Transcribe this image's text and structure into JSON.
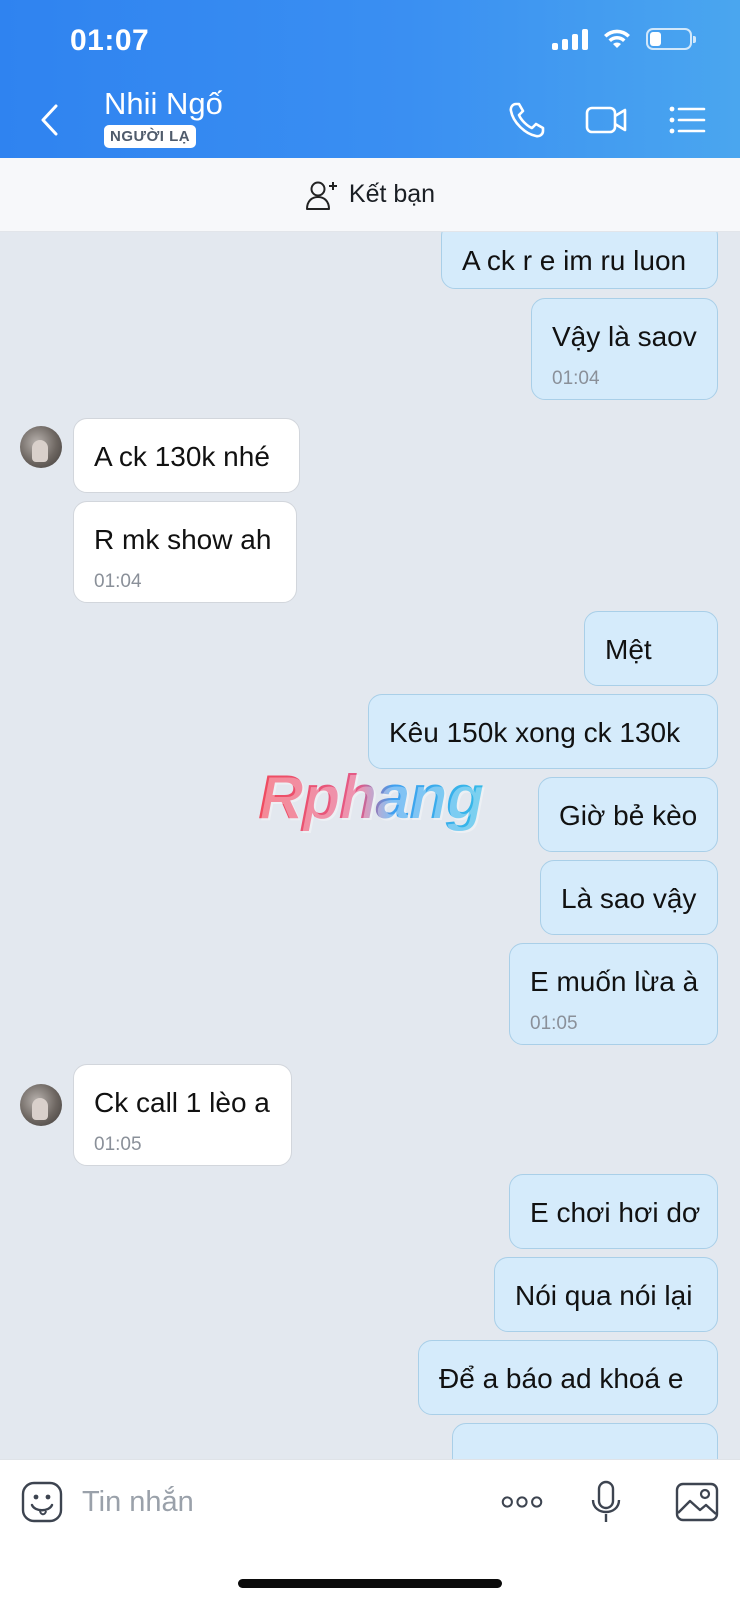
{
  "status_bar": {
    "time": "01:07"
  },
  "header": {
    "contact_name": "Nhii Ngố",
    "badge": "NGƯỜI LẠ",
    "icons": [
      "back-icon",
      "phone-icon",
      "video-call-icon",
      "menu-list-icon"
    ]
  },
  "friend_bar": {
    "label": "Kết bạn",
    "icon": "add-friend-icon"
  },
  "watermark": "Rphang",
  "messages": [
    {
      "side": "out",
      "text": "A ck r e im ru luon",
      "time": ""
    },
    {
      "side": "out",
      "text": "Vậy là saov",
      "time": "01:04"
    },
    {
      "side": "in",
      "text": "A ck 130k nhé",
      "time": ""
    },
    {
      "side": "in",
      "text": "R mk show ah",
      "time": "01:04"
    },
    {
      "side": "out",
      "text": "Mệt",
      "time": ""
    },
    {
      "side": "out",
      "text": "Kêu 150k xong ck 130k",
      "time": ""
    },
    {
      "side": "out",
      "text": "Giờ bẻ kèo",
      "time": ""
    },
    {
      "side": "out",
      "text": "Là sao vậy",
      "time": ""
    },
    {
      "side": "out",
      "text": "E muốn lừa à",
      "time": "01:05"
    },
    {
      "side": "in",
      "text": "Ck call 1 lèo a",
      "time": "01:05"
    },
    {
      "side": "out",
      "text": "E chơi hơi dơ",
      "time": ""
    },
    {
      "side": "out",
      "text": "Nói qua nói lại",
      "time": ""
    },
    {
      "side": "out",
      "text": "Để a báo ad khoá e",
      "time": ""
    }
  ],
  "input_bar": {
    "placeholder": "Tin nhắn",
    "icons": [
      "sticker-icon",
      "more-icon",
      "microphone-icon",
      "image-icon"
    ]
  },
  "colors": {
    "header_start": "#2f83f0",
    "header_end": "#4aa6ef",
    "outgoing_bubble": "#d5ebfb",
    "incoming_bubble": "#ffffff",
    "chat_background": "#e3e8ef"
  }
}
